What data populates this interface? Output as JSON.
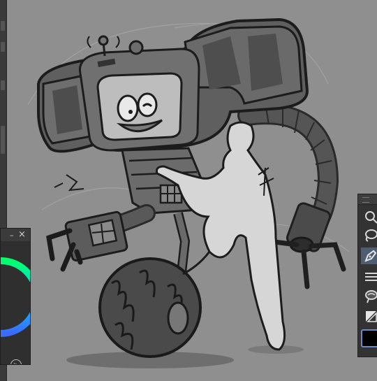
{
  "canvas": {
    "subject": "robot-hug-sketch"
  },
  "color_panel": {
    "minimize_icon": "minimize-icon",
    "close_icon": "close-icon",
    "play_icon": "play-icon",
    "minimize_glyph": "–",
    "close_glyph": "×",
    "play_glyph": "▷"
  },
  "toolbar": {
    "tools": [
      "zoom-icon",
      "lasso-icon",
      "pen-icon",
      "hatch-icon",
      "blend-icon",
      "fill-icon"
    ],
    "active_tool": "pen-icon",
    "current_color": "#000000",
    "accent": "#6a8cc6"
  }
}
